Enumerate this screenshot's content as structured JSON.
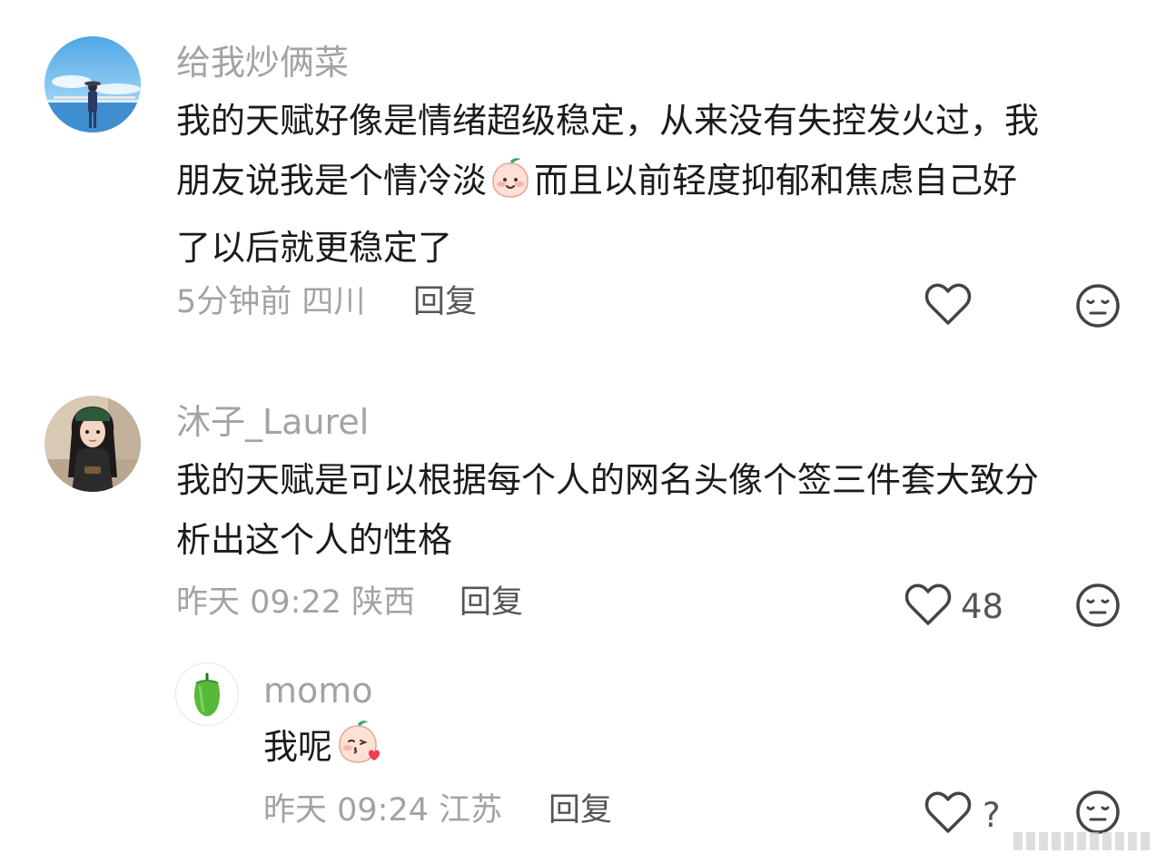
{
  "comments": [
    {
      "username": "给我炒俩菜",
      "text_lines": [
        "我的天赋好像是情绪超级稳定，从来没有失控发火过，我",
        "朋友说我是个情冷淡",
        "而且以前轻度抑郁和焦虑自己好",
        "了以后就更稳定了"
      ],
      "meta": "5分钟前 四川",
      "reply_label": "回复",
      "like_count": ""
    },
    {
      "username": "沐子_Laurel",
      "text_lines": [
        "我的天赋是可以根据每个人的网名头像个签三件套大致分",
        "析出这个人的性格"
      ],
      "meta": "昨天 09:22 陕西",
      "reply_label": "回复",
      "like_count": "48"
    },
    {
      "username": "momo",
      "text_lines": [
        "我呢"
      ],
      "meta": "昨天 09:24 江苏",
      "reply_label": "回复",
      "like_count": "?"
    }
  ],
  "icons": {
    "like": "heart-outline-icon",
    "dislike": "neutral-face-icon",
    "emoji_smile": "peach-smile-emoji-icon",
    "emoji_kiss": "peach-kiss-emoji-icon",
    "avatar_momo": "green-pepper-icon"
  },
  "colors": {
    "username": "#a3a3a3",
    "body_text": "#1b1b1b",
    "meta": "#a3a3a3",
    "reply": "#555555",
    "icon": "#444444"
  }
}
